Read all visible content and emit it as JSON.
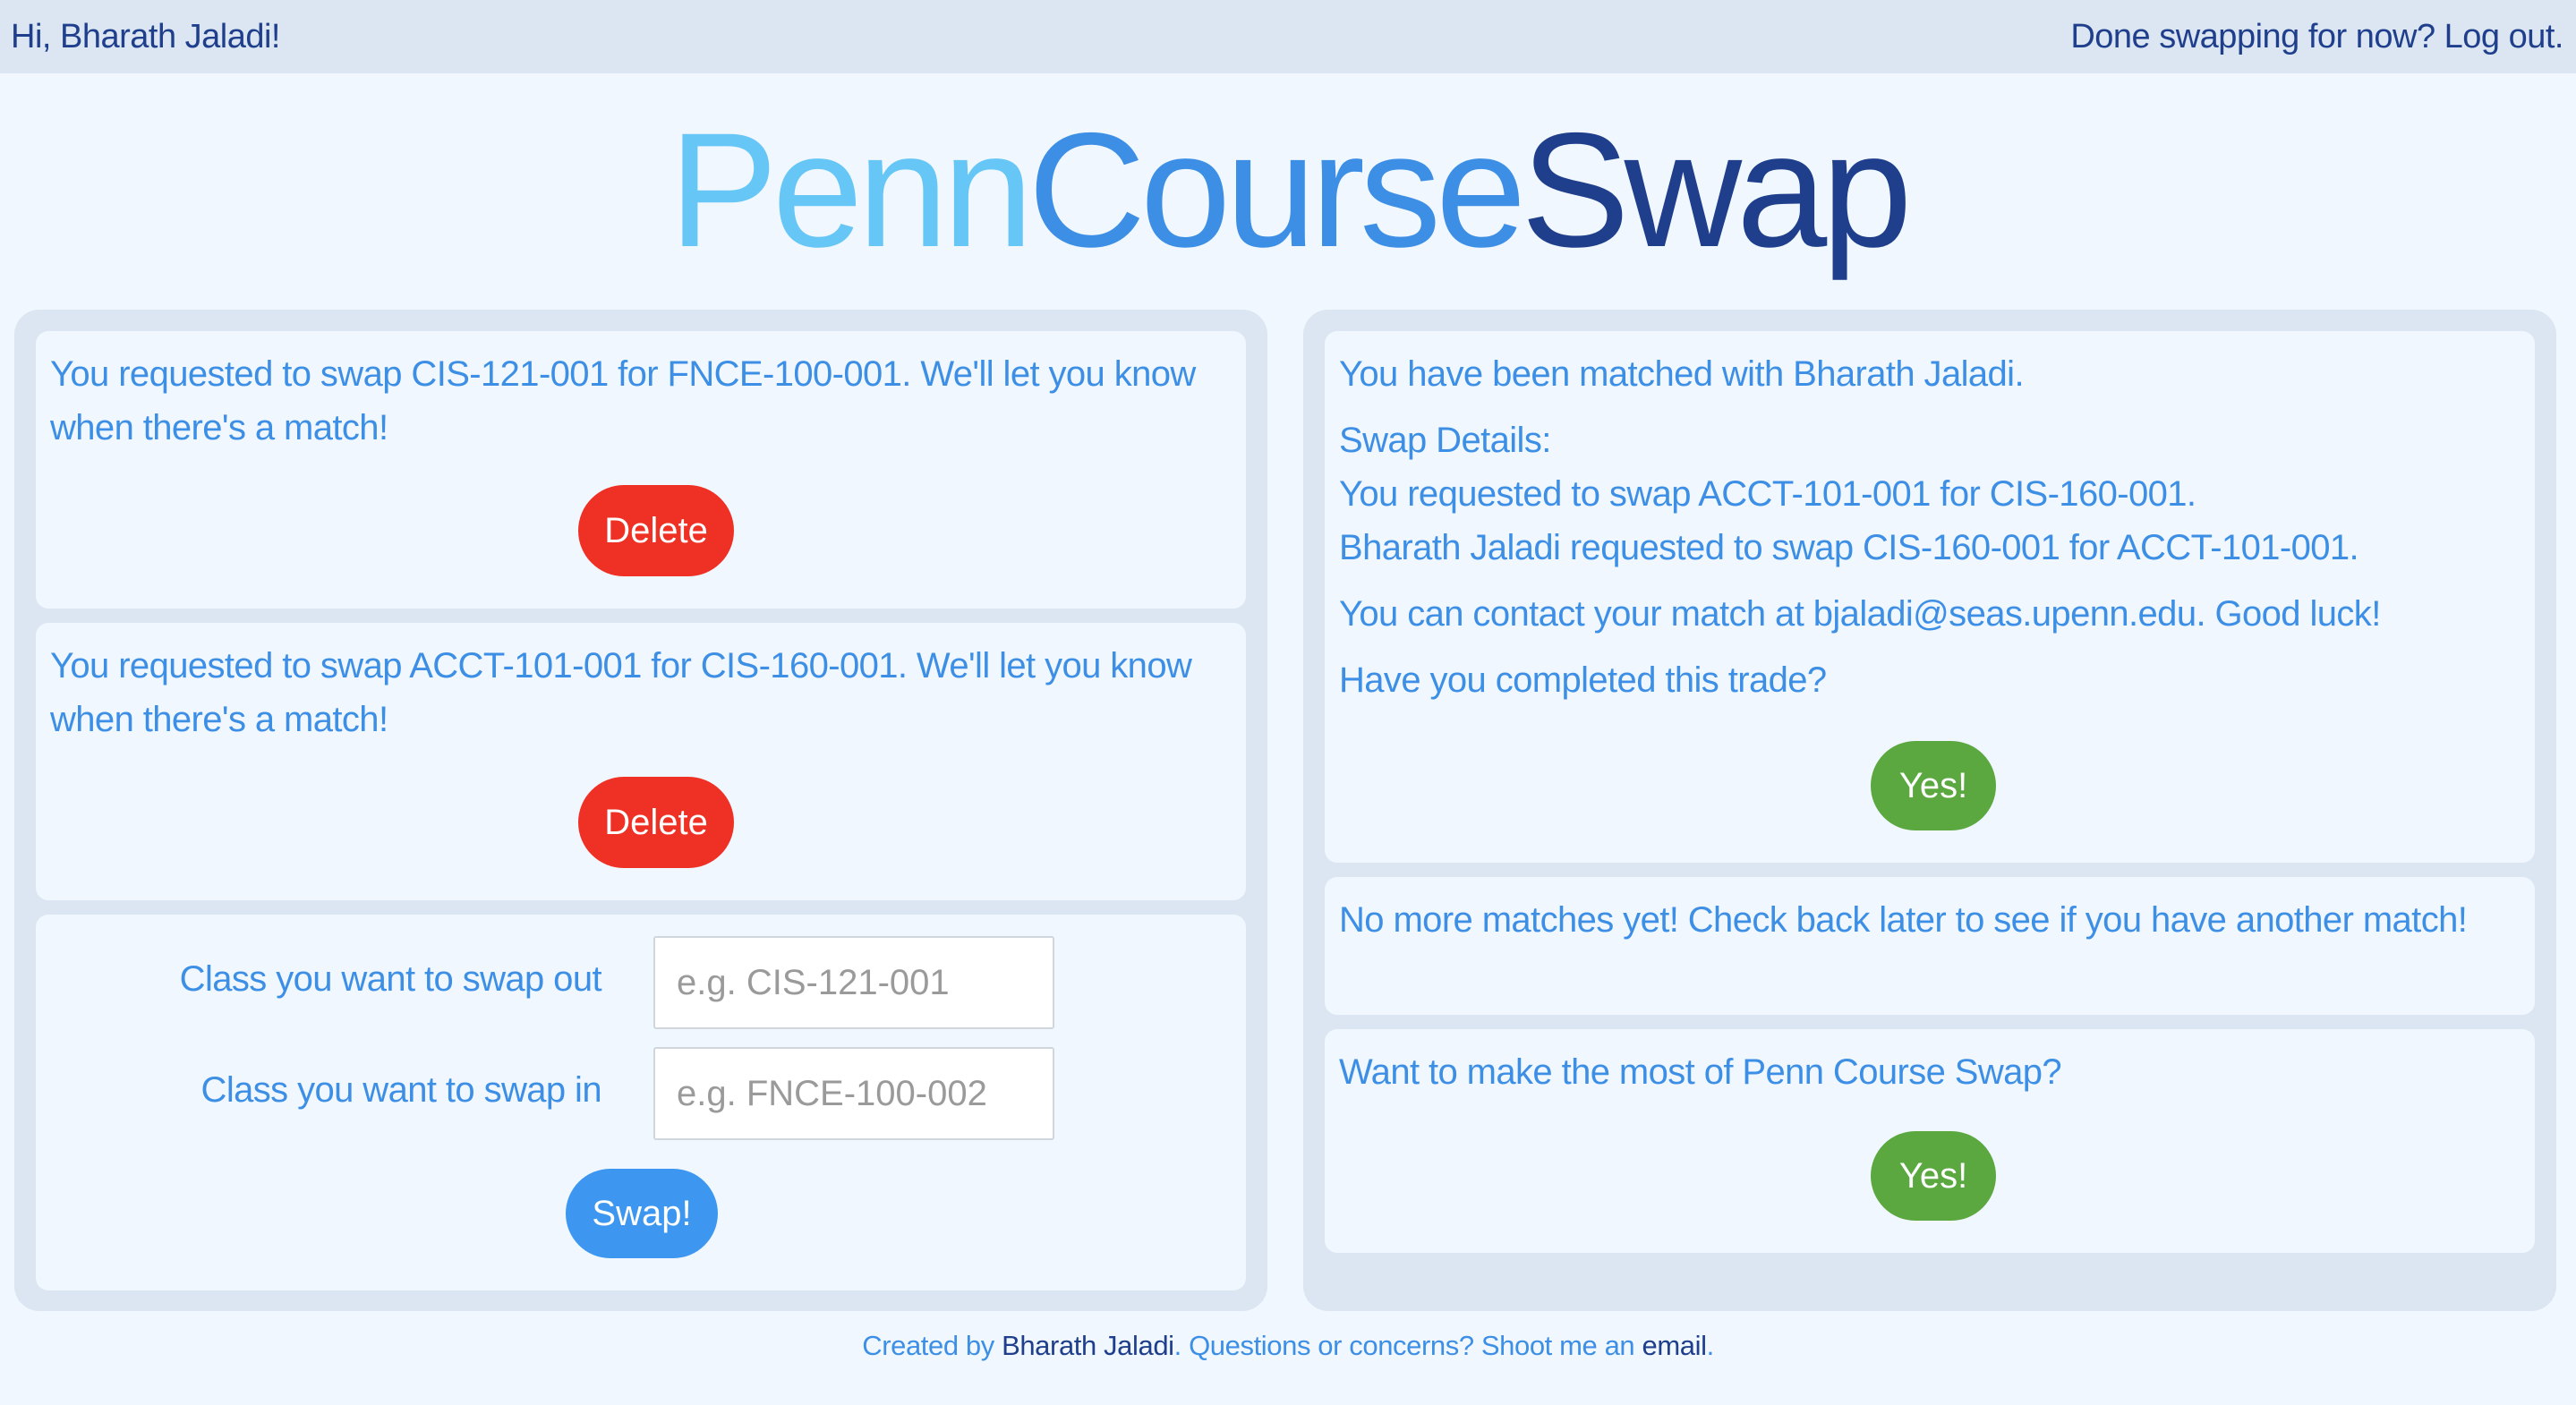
{
  "topbar": {
    "greeting": "Hi, Bharath Jaladi!",
    "logout": "Done swapping for now? Log out."
  },
  "brand": {
    "part1": "Penn",
    "part2": "Course",
    "part3": "Swap"
  },
  "requests": [
    {
      "text": "You requested to swap CIS-121-001 for FNCE-100-001. We'll let you know when there's a match!",
      "delete_label": "Delete"
    },
    {
      "text": "You requested to swap ACCT-101-001 for CIS-160-001. We'll let you know when there's a match!",
      "delete_label": "Delete"
    }
  ],
  "swap_form": {
    "out_label": "Class you want to swap out",
    "out_placeholder": "e.g. CIS-121-001",
    "out_value": "",
    "in_label": "Class you want to swap in",
    "in_placeholder": "e.g. FNCE-100-002",
    "in_value": "",
    "submit_label": "Swap!"
  },
  "match": {
    "matched_with": "You have been matched with Bharath Jaladi.",
    "details_heading": "Swap Details:",
    "your_request": "You requested to swap ACCT-101-001 for CIS-160-001.",
    "their_request": "Bharath Jaladi requested to swap CIS-160-001 for ACCT-101-001.",
    "contact": "You can contact your match at bjaladi@seas.upenn.edu. Good luck!",
    "question": "Have you completed this trade?",
    "yes_label": "Yes!"
  },
  "no_more": {
    "text": "No more matches yet! Check back later to see if you have another match!"
  },
  "promo": {
    "text": "Want to make the most of Penn Course Swap?",
    "yes_label": "Yes!"
  },
  "footer": {
    "prefix": "Created by ",
    "author": "Bharath Jaladi",
    "middle": ". Questions or concerns? Shoot me an ",
    "email_link": "email",
    "suffix": "."
  },
  "colors": {
    "background": "#f0f7fe",
    "panel": "#dbe6f2",
    "text_blue": "#3d8fe6",
    "dark_blue": "#1f3f8c",
    "light_blue": "#66c6f6",
    "delete_red": "#ee3124",
    "swap_blue": "#3d97f0",
    "yes_green": "#5aa83f"
  }
}
